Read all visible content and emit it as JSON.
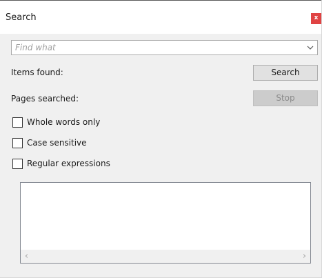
{
  "window": {
    "title": "Search",
    "close_label": "x"
  },
  "search": {
    "find_placeholder": "Find what",
    "find_value": "",
    "dropdown_icon": "chevron-down-icon"
  },
  "status": {
    "items_found_label": "Items found:",
    "pages_searched_label": "Pages searched:"
  },
  "buttons": {
    "search_label": "Search",
    "stop_label": "Stop"
  },
  "options": [
    {
      "label": "Whole words only",
      "checked": false
    },
    {
      "label": "Case sensitive",
      "checked": false
    },
    {
      "label": "Regular expressions",
      "checked": false
    }
  ],
  "results": {
    "items": [],
    "scroll_left_glyph": "‹",
    "scroll_right_glyph": "›"
  },
  "colors": {
    "close_button": "#e04343",
    "panel_background": "#f0f0f0"
  }
}
